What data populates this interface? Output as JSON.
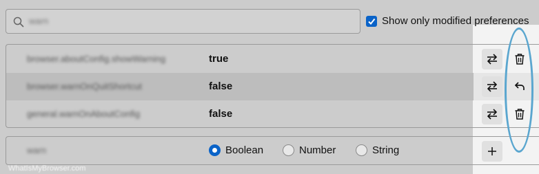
{
  "search": {
    "value": "warn",
    "icon": "search-icon"
  },
  "filter": {
    "checked": true,
    "label": "Show only modified preferences"
  },
  "prefs": [
    {
      "name": "browser.aboutConfig.showWarning",
      "value": "true",
      "toggle_icon": "toggle-icon",
      "action_icon": "trash-icon"
    },
    {
      "name": "browser.warnOnQuitShortcut",
      "value": "false",
      "toggle_icon": "toggle-icon",
      "action_icon": "undo-icon"
    },
    {
      "name": "general.warnOnAboutConfig",
      "value": "false",
      "toggle_icon": "toggle-icon",
      "action_icon": "trash-icon"
    }
  ],
  "add_row": {
    "name": "warn",
    "types": [
      {
        "label": "Boolean",
        "checked": true
      },
      {
        "label": "Number",
        "checked": false
      },
      {
        "label": "String",
        "checked": false
      }
    ],
    "add_icon": "plus-icon"
  },
  "watermark": "WhatIsMyBrowser.com",
  "colors": {
    "accent": "#0a63c8",
    "annotation": "#5aa6cf"
  }
}
